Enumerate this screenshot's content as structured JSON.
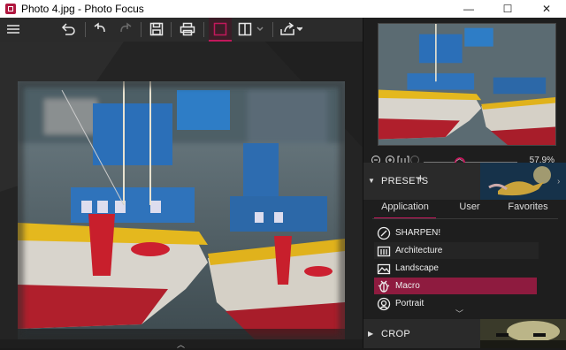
{
  "window": {
    "title": "Photo 4.jpg - Photo Focus",
    "minimize": "—",
    "maximize": "☐",
    "close": "✕"
  },
  "toolbar": {
    "items": [
      "menu-icon",
      "undo-all-icon",
      "undo-icon",
      "redo-icon",
      "save-icon",
      "print-icon",
      "crop-icon",
      "compare-icon",
      "compare-dropdown-icon",
      "share-icon"
    ]
  },
  "navigator": {
    "zoom_value": "57.9%",
    "zoom_fraction": 0.38
  },
  "presets": {
    "header": "PRESETS",
    "tabs": [
      "Application",
      "User",
      "Favorites"
    ],
    "active_tab": "Application",
    "items": [
      {
        "label": "SHARPEN!",
        "icon": "sharpen-icon"
      },
      {
        "label": "Architecture",
        "icon": "architecture-icon"
      },
      {
        "label": "Landscape",
        "icon": "landscape-icon"
      },
      {
        "label": "Macro",
        "icon": "macro-icon"
      },
      {
        "label": "Portrait",
        "icon": "portrait-icon"
      }
    ],
    "selected": "Macro"
  },
  "crop": {
    "header": "CROP"
  },
  "colors": {
    "accent": "#c2185b",
    "selected_row": "#8e1b3f",
    "panel_bg": "#1e1e1e",
    "toolbar_bg": "#2b2b2b"
  }
}
